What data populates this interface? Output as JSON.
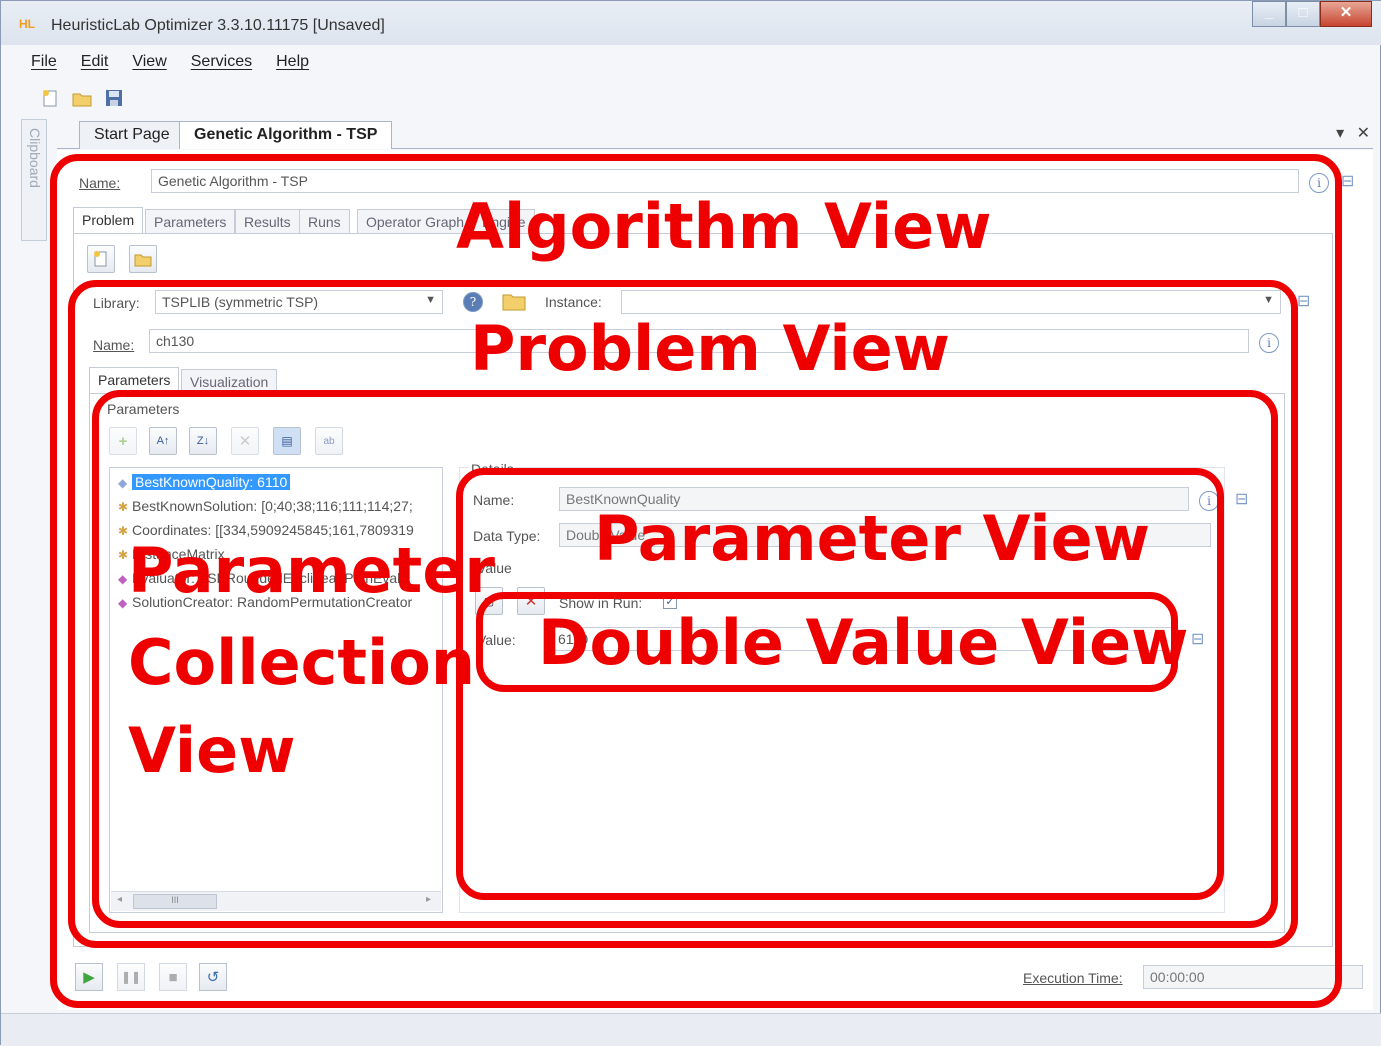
{
  "window": {
    "title": "HeuristicLab Optimizer 3.3.10.11175 [Unsaved]",
    "logo": "HL"
  },
  "menu": [
    "File",
    "Edit",
    "View",
    "Services",
    "Help"
  ],
  "sidebar": {
    "label": "Clipboard",
    "logo": "HL"
  },
  "doc_tabs": [
    "Start Page",
    "Genetic Algorithm - TSP"
  ],
  "tab_controls": {
    "dropdown": "▾",
    "close": "✕"
  },
  "algorithm": {
    "name_label": "Name:",
    "name_value": "Genetic Algorithm - TSP",
    "tabs": [
      "Problem",
      "Parameters",
      "Results",
      "Runs",
      "Operator Graph",
      "Engine"
    ]
  },
  "problem": {
    "library_label": "Library:",
    "library_value": "TSPLIB (symmetric TSP)",
    "instance_label": "Instance:",
    "instance_value": "",
    "name_label": "Name:",
    "name_value": "ch130",
    "tabs": [
      "Parameters",
      "Visualization"
    ]
  },
  "parameters": {
    "group_label": "Parameters",
    "items": [
      "BestKnownQuality: 6110",
      "BestKnownSolution: [0;40;38;116;111;114;27;",
      "Coordinates: [[334,5909245845;161,7809319",
      "DistanceMatrix",
      "Evaluator: TSPRoundedEuclideanPathEvalu",
      "SolutionCreator: RandomPermutationCreator"
    ],
    "scroll_thumb": "III"
  },
  "details": {
    "group_label": "Details",
    "name_label": "Name:",
    "name_value": "BestKnownQuality",
    "type_label": "Data Type:",
    "type_value": "DoubleValue",
    "value_group": "Value",
    "show_in_run_label": "Show in Run:",
    "value_label": "Value:",
    "value_value": "6110"
  },
  "execution": {
    "label": "Execution Time:",
    "value": "00:00:00"
  },
  "annotations": {
    "algorithm_view": "Algorithm View",
    "problem_view": "Problem View",
    "parameter_view": "Parameter View",
    "double_value_view": "Double Value View",
    "param_collection_1": "Parameter",
    "param_collection_2": "Collection",
    "param_collection_3": "View"
  },
  "colors": {
    "annotation": "#ee0000",
    "selection": "#3399ff",
    "chrome": "#dde4ee"
  }
}
